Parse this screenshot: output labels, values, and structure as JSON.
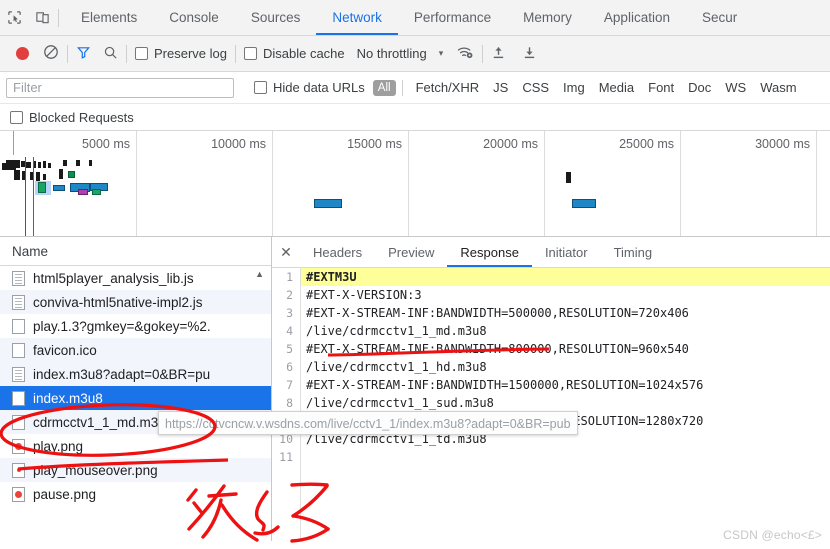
{
  "devtools": {
    "toolbar_icons": [
      "inspect-element-icon",
      "device-toolbar-icon"
    ],
    "tabs": [
      {
        "label": "Elements",
        "active": false
      },
      {
        "label": "Console",
        "active": false
      },
      {
        "label": "Sources",
        "active": false
      },
      {
        "label": "Network",
        "active": true
      },
      {
        "label": "Performance",
        "active": false
      },
      {
        "label": "Memory",
        "active": false
      },
      {
        "label": "Application",
        "active": false
      },
      {
        "label": "Secur",
        "active": false
      }
    ]
  },
  "controls": {
    "record_label": "record-button",
    "clear_label": "clear-button",
    "filter_icon": "filter-icon",
    "search_icon": "search-icon",
    "preserve_log": "Preserve log",
    "disable_cache": "Disable cache",
    "throttling": "No throttling",
    "caret": "▾",
    "wifi_icon": "network-conditions-icon",
    "import_icon": "import-har-icon",
    "export_icon": "export-har-icon"
  },
  "filterbar": {
    "placeholder": "Filter",
    "value": "",
    "hide_data_urls": "Hide data URLs",
    "types": [
      "All",
      "Fetch/XHR",
      "JS",
      "CSS",
      "Img",
      "Media",
      "Font",
      "Doc",
      "WS",
      "Wasm"
    ],
    "selected_type": "All",
    "blocked_requests": "Blocked Requests"
  },
  "overview": {
    "ticks": [
      "5000 ms",
      "10000 ms",
      "15000 ms",
      "20000 ms",
      "25000 ms",
      "30000 ms"
    ]
  },
  "request_list": {
    "column_header": "Name",
    "scroll_indicator": "▲",
    "items": [
      {
        "name": "html5player_analysis_lib.js",
        "icon": "script-file-icon",
        "state": "normal"
      },
      {
        "name": "conviva-html5native-impl2.js",
        "icon": "script-file-icon",
        "state": "alt"
      },
      {
        "name": "play.1.3?gmkey=&gokey=%2.",
        "icon": "generic-file-icon",
        "state": "normal"
      },
      {
        "name": "favicon.ico",
        "icon": "generic-file-icon",
        "state": "alt"
      },
      {
        "name": "index.m3u8?adapt=0&BR=pu",
        "icon": "script-file-icon",
        "state": "alt"
      },
      {
        "name": "index.m3u8",
        "icon": "generic-file-icon",
        "state": "selected"
      },
      {
        "name": "cdrmcctv1_1_md.m3u8",
        "icon": "generic-file-icon",
        "state": "alt"
      },
      {
        "name": "play.png",
        "icon": "image-file-icon",
        "state": "normal"
      },
      {
        "name": "play_mouseover.png",
        "icon": "image-file-icon-small",
        "state": "alt"
      },
      {
        "name": "pause.png",
        "icon": "image-file-icon",
        "state": "normal"
      }
    ]
  },
  "tooltip": {
    "text": "https://cctvcncw.v.wsdns.com/live/cctv1_1/index.m3u8?adapt=0&BR=pub"
  },
  "detail": {
    "close_icon": "close-icon",
    "tabs": [
      {
        "label": "Headers",
        "active": false
      },
      {
        "label": "Preview",
        "active": false
      },
      {
        "label": "Response",
        "active": true
      },
      {
        "label": "Initiator",
        "active": false
      },
      {
        "label": "Timing",
        "active": false
      }
    ],
    "response_lines": [
      {
        "n": "1",
        "text": "#EXTM3U",
        "highlight": true
      },
      {
        "n": "2",
        "text": "#EXT-X-VERSION:3",
        "highlight": false
      },
      {
        "n": "3",
        "text": "#EXT-X-STREAM-INF:BANDWIDTH=500000,RESOLUTION=720x406",
        "highlight": false
      },
      {
        "n": "4",
        "text": "/live/cdrmcctv1_1_md.m3u8",
        "highlight": false
      },
      {
        "n": "5",
        "text": "#EXT-X-STREAM-INF:BANDWIDTH=800000,RESOLUTION=960x540",
        "highlight": false
      },
      {
        "n": "6",
        "text": "/live/cdrmcctv1_1_hd.m3u8",
        "highlight": false
      },
      {
        "n": "7",
        "text": "#EXT-X-STREAM-INF:BANDWIDTH=1500000,RESOLUTION=1024x576",
        "highlight": false
      },
      {
        "n": "8",
        "text": "/live/cdrmcctv1_1_sud.m3u8",
        "highlight": false
      },
      {
        "n": "9",
        "text": "#EXT-X-STREAM-INF:BANDWIDTH=2000000,RESOLUTION=1280x720",
        "highlight": false
      },
      {
        "n": "10",
        "text": "/live/cdrmcctv1_1_td.m3u8",
        "highlight": false
      },
      {
        "n": "11",
        "text": "",
        "highlight": false
      }
    ]
  },
  "annotations": {
    "handwriting": "次级",
    "color": "#ee1111"
  },
  "watermark": {
    "text": "CSDN @echo<£>"
  }
}
